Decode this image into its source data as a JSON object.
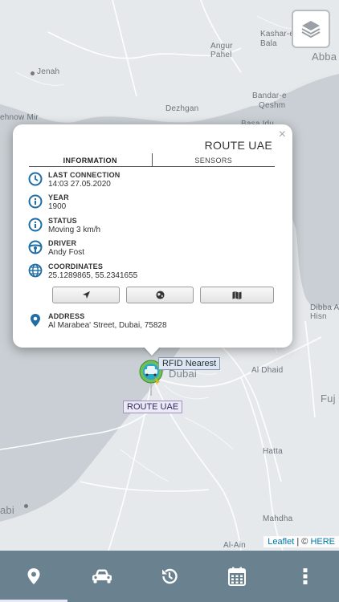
{
  "map": {
    "labels": {
      "kashar_e": "Kashar-e",
      "bala": "Bala",
      "angur": "Angur",
      "pahel": "Pahel",
      "abba": "Abba",
      "jenah": "Jenah",
      "bandar_e": "Bandar-e",
      "qeshm": "Qeshm",
      "dezhgan": "Dezhgan",
      "ehnow_mir": "ehnow Mir",
      "basa_idu": "Basa Idu",
      "dibba_al": "Dibba Al",
      "hisn": "Hisn",
      "dubai": "Dubai",
      "al_dhaid": "Al Dhaid",
      "fuj": "Fuj",
      "hatta": "Hatta",
      "abi": "abi",
      "mahdha": "Mahdha",
      "al_ain": "Al-Ain"
    },
    "attribution": {
      "leaflet": "Leaflet",
      "sep": " | © ",
      "here": "HERE"
    }
  },
  "popup": {
    "close": "×",
    "title": "ROUTE UAE",
    "tabs": [
      "INFORMATION",
      "SENSORS"
    ],
    "fields": [
      {
        "label": "LAST CONNECTION",
        "value": "14:03 27.05.2020",
        "icon": "clock-icon"
      },
      {
        "label": "YEAR",
        "value": "1900",
        "icon": "info-icon"
      },
      {
        "label": "STATUS",
        "value": "Moving 3 km/h",
        "icon": "info-icon"
      },
      {
        "label": "DRIVER",
        "value": "Andy Fost",
        "icon": "steering-wheel-icon"
      },
      {
        "label": "COORDINATES",
        "value": "25.1289865, 55.2341655",
        "icon": "globe-icon"
      }
    ],
    "buttons": [
      "navigate-arrow-icon",
      "globe-icon",
      "map-icon"
    ],
    "address": {
      "label": "ADDRESS",
      "value": "Al Marabea' Street, Dubai, 75828",
      "icon": "map-pin-icon"
    }
  },
  "markers": {
    "rfid": "RFID Nearest",
    "route": "ROUTE UAE"
  },
  "colors": {
    "accent": "#2a7fb0",
    "navbar": "#6a8290",
    "icon": "#1f6ea6"
  },
  "navbar": {
    "items": [
      "map-pin-icon",
      "car-icon",
      "history-icon",
      "calendar-icon",
      "more-vertical-icon"
    ],
    "active": 0
  }
}
